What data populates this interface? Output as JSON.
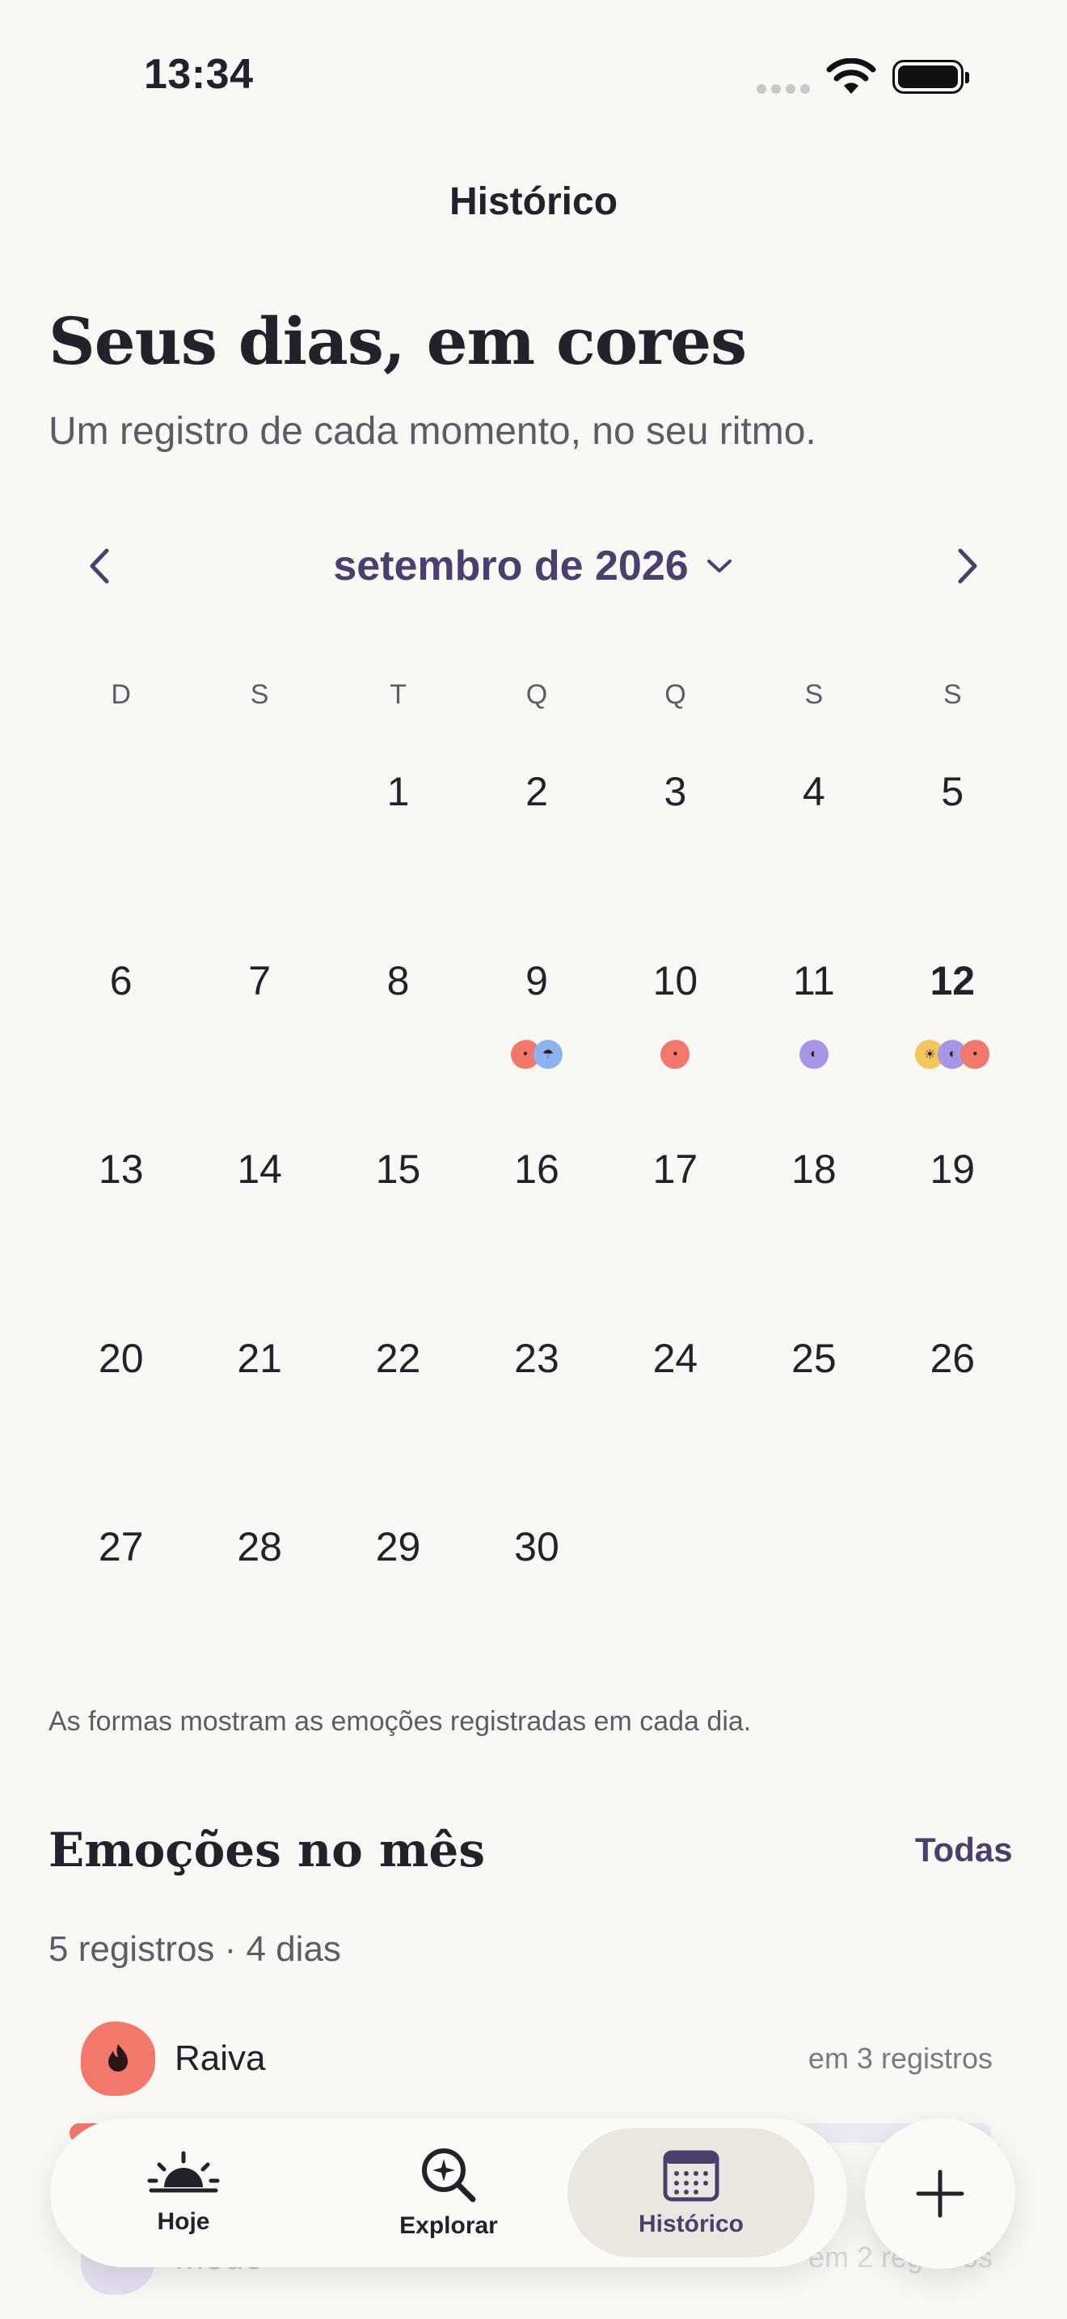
{
  "status_bar": {
    "time": "13:34"
  },
  "header": {
    "title": "Histórico"
  },
  "hero": {
    "title": "Seus dias, em cores",
    "subtitle": "Um registro de cada momento, no seu ritmo."
  },
  "calendar": {
    "month_label": "setembro de 2026",
    "weekdays": [
      "D",
      "S",
      "T",
      "Q",
      "Q",
      "S",
      "S"
    ],
    "leading_blanks": 2,
    "days": [
      {
        "n": "1",
        "marks": []
      },
      {
        "n": "2",
        "marks": []
      },
      {
        "n": "3",
        "marks": []
      },
      {
        "n": "4",
        "marks": []
      },
      {
        "n": "5",
        "marks": []
      },
      {
        "n": "6",
        "marks": []
      },
      {
        "n": "7",
        "marks": []
      },
      {
        "n": "8",
        "marks": []
      },
      {
        "n": "9",
        "marks": [
          "raiva",
          "calma"
        ]
      },
      {
        "n": "10",
        "marks": [
          "raiva"
        ]
      },
      {
        "n": "11",
        "marks": [
          "medo"
        ]
      },
      {
        "n": "12",
        "marks": [
          "alegria",
          "medo",
          "raiva"
        ],
        "today": true
      },
      {
        "n": "13",
        "marks": []
      },
      {
        "n": "14",
        "marks": []
      },
      {
        "n": "15",
        "marks": []
      },
      {
        "n": "16",
        "marks": []
      },
      {
        "n": "17",
        "marks": []
      },
      {
        "n": "18",
        "marks": []
      },
      {
        "n": "19",
        "marks": []
      },
      {
        "n": "20",
        "marks": []
      },
      {
        "n": "21",
        "marks": []
      },
      {
        "n": "22",
        "marks": []
      },
      {
        "n": "23",
        "marks": []
      },
      {
        "n": "24",
        "marks": []
      },
      {
        "n": "25",
        "marks": []
      },
      {
        "n": "26",
        "marks": []
      },
      {
        "n": "27",
        "marks": []
      },
      {
        "n": "28",
        "marks": []
      },
      {
        "n": "29",
        "marks": []
      },
      {
        "n": "30",
        "marks": []
      }
    ],
    "hint": "As formas mostram as emoções registradas em cada dia."
  },
  "mark_icons": {
    "raiva": "flame-icon",
    "calma": "cloud-rain-icon",
    "medo": "half-moon-icon",
    "alegria": "sun-icon"
  },
  "emotions_section": {
    "title": "Emoções no mês",
    "link": "Todas",
    "summary": "5 registros · 4 dias",
    "items": [
      {
        "name": "Raiva",
        "count": "em 3 registros",
        "share": 0.6,
        "color": "#f1786a"
      },
      {
        "name": "Medo",
        "count": "em 2 registros",
        "share": 0.4,
        "color": "#a995e6"
      }
    ]
  },
  "tabbar": {
    "tabs": [
      {
        "label": "Hoje",
        "icon": "sunrise-icon"
      },
      {
        "label": "Explorar",
        "icon": "sparkle-search-icon"
      },
      {
        "label": "Histórico",
        "icon": "calendar-icon",
        "active": true
      }
    ],
    "fab_icon": "plus-icon"
  }
}
